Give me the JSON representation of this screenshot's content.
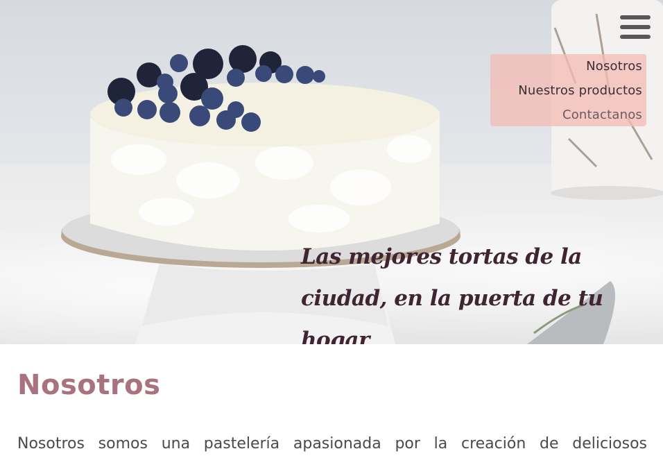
{
  "hero": {
    "tagline": "Las mejores tortas de la ciudad, en la puerta de tu hogar",
    "image_subject": "cake-with-berries"
  },
  "nav": {
    "menu_icon": "hamburger-icon",
    "items": [
      {
        "label": "Nosotros"
      },
      {
        "label": "Nuestros productos"
      },
      {
        "label": "Contactanos"
      }
    ]
  },
  "about": {
    "title": "Nosotros",
    "text": "Nosotros somos una pastelería apasionada por la creación de deliciosos"
  },
  "colors": {
    "accent": "#a8737f",
    "nav_bg": "#f4bcb6",
    "tagline": "#3f2532"
  }
}
